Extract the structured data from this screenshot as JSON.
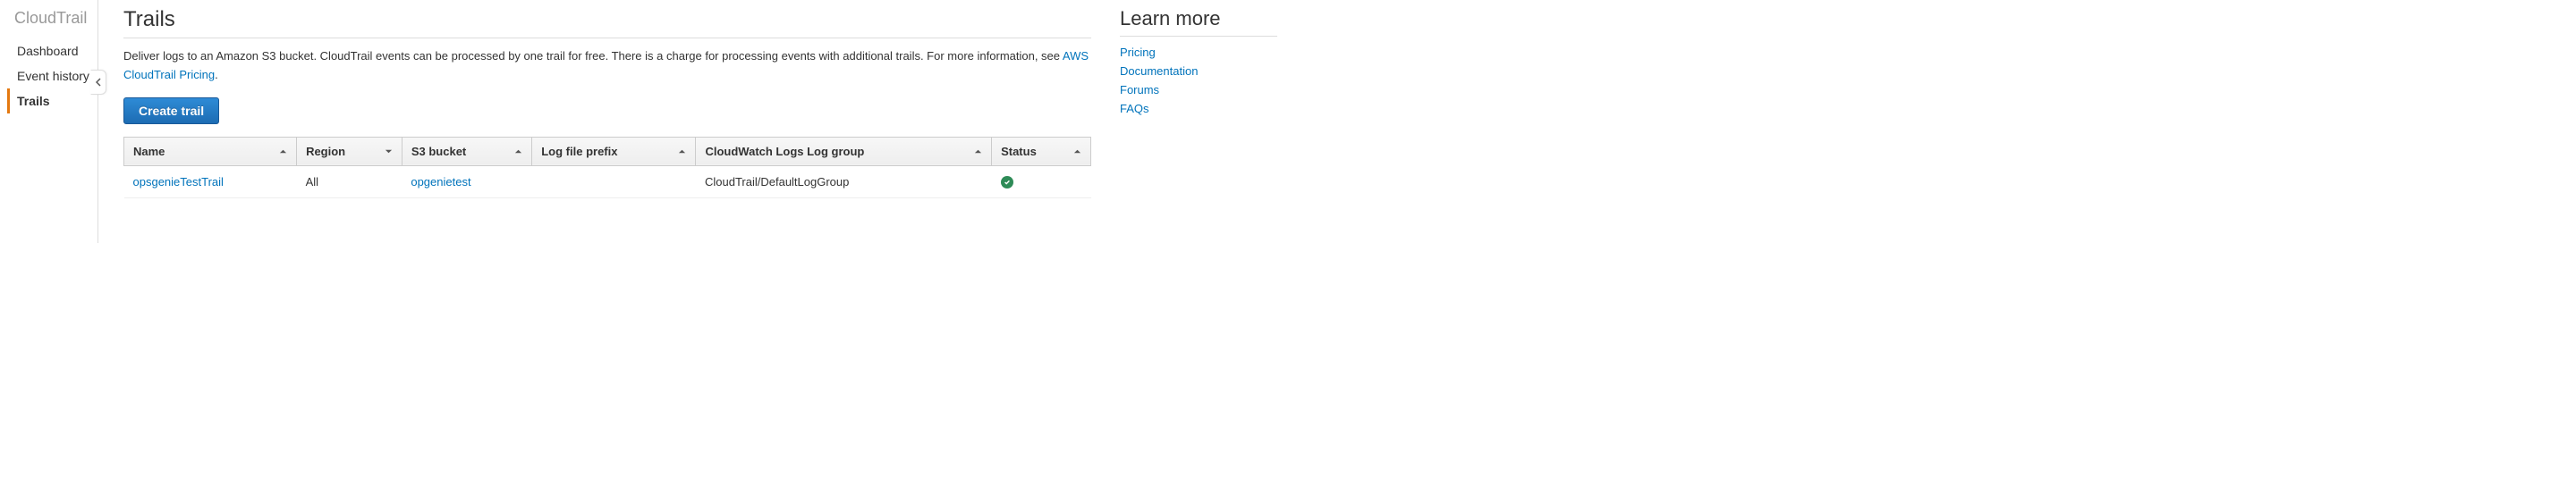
{
  "sidebar": {
    "title": "CloudTrail",
    "items": [
      {
        "label": "Dashboard",
        "active": false
      },
      {
        "label": "Event history",
        "active": false
      },
      {
        "label": "Trails",
        "active": true
      }
    ]
  },
  "main": {
    "title": "Trails",
    "description_part1": "Deliver logs to an Amazon S3 bucket. CloudTrail events can be processed by one trail for free. There is a charge for processing events with additional trails. For more information, see ",
    "description_link": "AWS CloudTrail Pricing",
    "description_part2": ".",
    "create_button": "Create trail",
    "table": {
      "columns": [
        {
          "label": "Name",
          "sort": "asc"
        },
        {
          "label": "Region",
          "sort": "desc"
        },
        {
          "label": "S3 bucket",
          "sort": "asc"
        },
        {
          "label": "Log file prefix",
          "sort": "asc"
        },
        {
          "label": "CloudWatch Logs Log group",
          "sort": "asc"
        },
        {
          "label": "Status",
          "sort": "asc"
        }
      ],
      "rows": [
        {
          "name": "opsgenieTestTrail",
          "region": "All",
          "s3_bucket": "opgenietest",
          "log_file_prefix": "",
          "cloudwatch_group": "CloudTrail/DefaultLogGroup",
          "status": "ok"
        }
      ]
    }
  },
  "right": {
    "title": "Learn more",
    "links": [
      {
        "label": "Pricing"
      },
      {
        "label": "Documentation"
      },
      {
        "label": "Forums"
      },
      {
        "label": "FAQs"
      }
    ]
  }
}
